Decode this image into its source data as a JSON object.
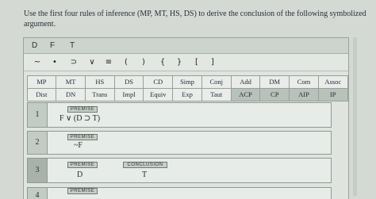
{
  "instructions": "Use the first four rules of inference (MP, MT, HS, DS) to derive the conclusion of the following symbolized argument.",
  "tabs": [
    "D",
    "F",
    "T"
  ],
  "symbols": [
    "~",
    "•",
    "⊃",
    "∨",
    "≡",
    "(",
    ")",
    "{",
    "}",
    "[",
    "]"
  ],
  "rules_row1": [
    "MP",
    "MT",
    "HS",
    "DS",
    "CD",
    "Simp",
    "Conj",
    "Add",
    "DM",
    "Com",
    "Assoc"
  ],
  "rules_row2": [
    "Dist",
    "DN",
    "Trans",
    "Impl",
    "Equiv",
    "Exp",
    "Taut",
    "ACP",
    "CP",
    "AIP",
    "IP"
  ],
  "lines": [
    {
      "num": "1",
      "tag": "PREMISE",
      "formula": "F ∨ (D ⊃ T)"
    },
    {
      "num": "2",
      "tag": "PREMISE",
      "formula": "~F"
    },
    {
      "num": "3",
      "tag": "PREMISE",
      "formula": "D",
      "tag2": "CONCLUSION",
      "formula2": "T"
    },
    {
      "num": "4",
      "tag": "PREMISE",
      "formula": ""
    }
  ]
}
